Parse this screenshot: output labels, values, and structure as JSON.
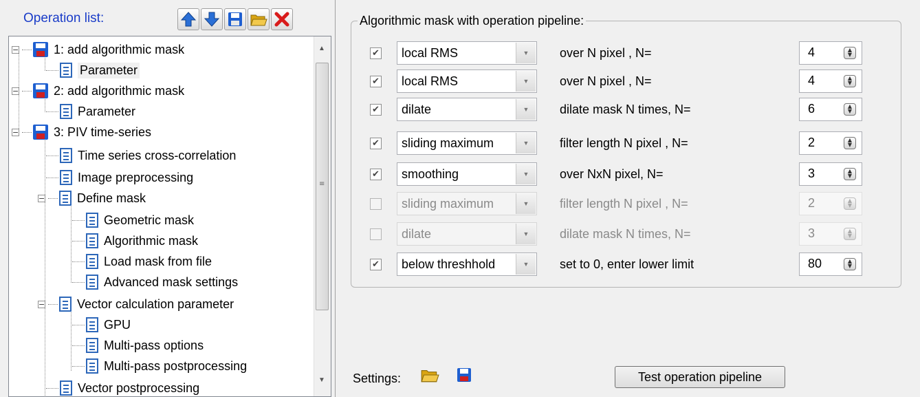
{
  "operation_list": {
    "title": "Operation list:",
    "toolbar": [
      {
        "name": "move-up-icon",
        "color": "#2a6fd6"
      },
      {
        "name": "move-down-icon",
        "color": "#2a6fd6"
      },
      {
        "name": "save-icon",
        "color": "#1e5fd0"
      },
      {
        "name": "open-folder-icon",
        "color": "#e8b417"
      },
      {
        "name": "delete-icon",
        "color": "#d91c1c"
      }
    ],
    "tree": [
      {
        "label": "1: add algorithmic mask",
        "icon": "floppy"
      },
      {
        "label": "Parameter",
        "icon": "doc"
      },
      {
        "label": "2: add algorithmic mask",
        "icon": "floppy"
      },
      {
        "label": "Parameter",
        "icon": "doc"
      },
      {
        "label": "3: PIV time-series",
        "icon": "floppy"
      },
      {
        "label": "Time series cross-correlation",
        "icon": "doc"
      },
      {
        "label": "Image preprocessing",
        "icon": "doc"
      },
      {
        "label": "Define mask",
        "icon": "doc"
      },
      {
        "label": "Geometric mask",
        "icon": "doc"
      },
      {
        "label": "Algorithmic mask",
        "icon": "doc"
      },
      {
        "label": "Load mask from file",
        "icon": "doc"
      },
      {
        "label": "Advanced mask settings",
        "icon": "doc"
      },
      {
        "label": "Vector calculation parameter",
        "icon": "doc"
      },
      {
        "label": "GPU",
        "icon": "doc"
      },
      {
        "label": "Multi-pass options",
        "icon": "doc"
      },
      {
        "label": "Multi-pass postprocessing",
        "icon": "doc"
      },
      {
        "label": "Vector postprocessing",
        "icon": "doc"
      }
    ]
  },
  "pipeline": {
    "title": "Algorithmic mask with operation pipeline:",
    "rows": [
      {
        "checked": true,
        "operation": "local RMS",
        "label": "over N pixel , N=",
        "value": "4",
        "enabled": true
      },
      {
        "checked": true,
        "operation": "local RMS",
        "label": "over N pixel , N=",
        "value": "4",
        "enabled": true
      },
      {
        "checked": true,
        "operation": "dilate",
        "label": "dilate mask N times, N=",
        "value": "6",
        "enabled": true
      },
      {
        "checked": true,
        "operation": "sliding maximum",
        "label": "filter length N pixel , N=",
        "value": "2",
        "enabled": true
      },
      {
        "checked": true,
        "operation": "smoothing",
        "label": "over NxN pixel, N=",
        "value": "3",
        "enabled": true
      },
      {
        "checked": false,
        "operation": "sliding maximum",
        "label": "filter length N pixel , N=",
        "value": "2",
        "enabled": false
      },
      {
        "checked": false,
        "operation": "dilate",
        "label": "dilate mask N times, N=",
        "value": "3",
        "enabled": false
      },
      {
        "checked": true,
        "operation": "below threshhold",
        "label": "set to 0, enter lower limit",
        "value": "80",
        "enabled": true
      }
    ]
  },
  "settings": {
    "label": "Settings:",
    "test_button": "Test operation pipeline"
  },
  "colors": {
    "title_blue": "#1a3cc8",
    "accent_blue": "#1e5fd0",
    "red": "#d91c1c",
    "folder_yellow": "#e8b417"
  }
}
